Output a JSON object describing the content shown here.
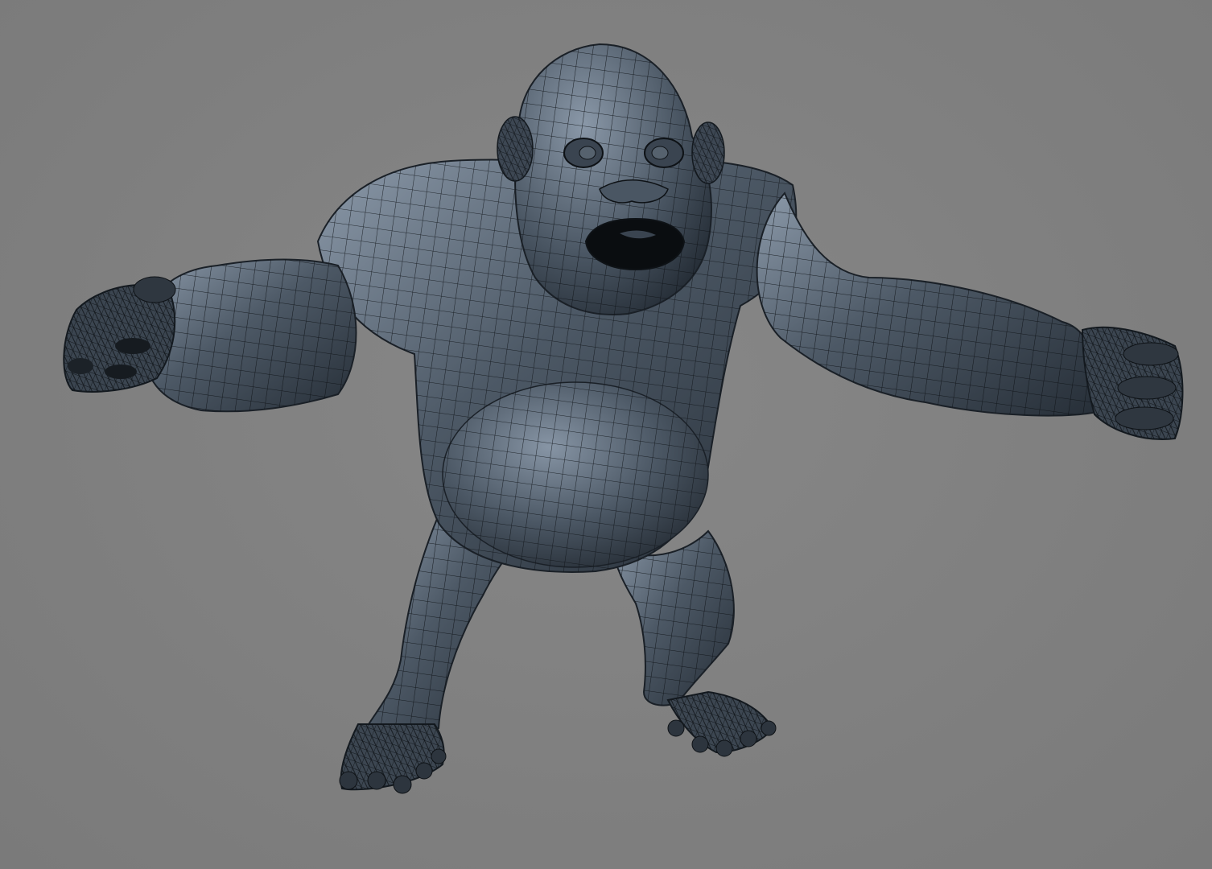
{
  "viewport": {
    "background_color": "#808080",
    "mesh_fill_color": "#4a5663",
    "mesh_fill_light": "#8796a6",
    "mesh_fill_dark": "#27303a",
    "wire_color": "#0e1216"
  },
  "model": {
    "subject": "gorilla-wireframe-mesh",
    "display_mode": "shaded-with-wireframe"
  }
}
